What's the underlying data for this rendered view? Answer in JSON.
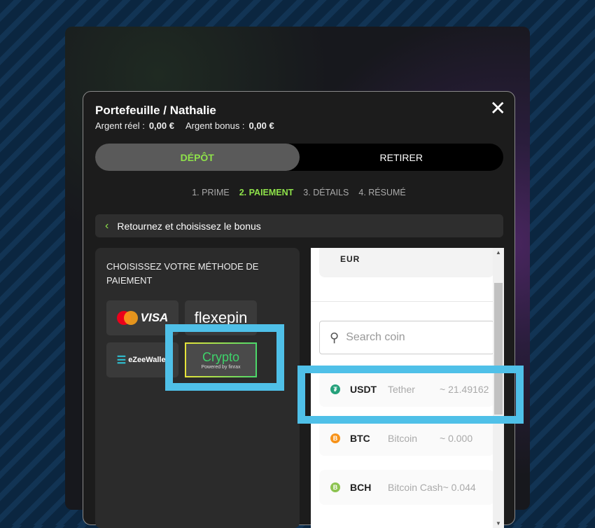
{
  "modal": {
    "title": "Portefeuille / Nathalie",
    "real_label": "Argent réel :",
    "real_value": "0,00 €",
    "bonus_label": "Argent bonus :",
    "bonus_value": "0,00 €",
    "close_icon": "close-icon"
  },
  "tabs": [
    {
      "label": "DÉPÔT",
      "active": true
    },
    {
      "label": "RETIRER",
      "active": false
    }
  ],
  "steps": [
    {
      "label": "1. PRIME"
    },
    {
      "label": "2. PAIEMENT",
      "current": true
    },
    {
      "label": "3. DÉTAILS"
    },
    {
      "label": "4. RÉSUMÉ"
    }
  ],
  "back": {
    "label": "Retournez et choisissez le bonus"
  },
  "methods": {
    "heading": "CHOISISSEZ VOTRE MÉTHODE DE PAIEMENT",
    "visa": "VISA",
    "mastercard": "mastercard",
    "flexepin": "flexepin",
    "ezeewallet": "eZeeWallet",
    "crypto": "Crypto",
    "crypto_sub": "Powered by finrax"
  },
  "coins": {
    "currency": "EUR",
    "search_placeholder": "Search coin",
    "list": [
      {
        "symbol": "USDT",
        "name": "Tether",
        "amount": "~ 21.49162",
        "color": "#26a17b"
      },
      {
        "symbol": "BTC",
        "name": "Bitcoin",
        "amount": "~ 0.000",
        "color": "#f7931a"
      },
      {
        "symbol": "BCH",
        "name": "Bitcoin Cash",
        "amount": "~ 0.044",
        "color": "#8dc351"
      }
    ]
  },
  "highlight_color": "#4fc0e8",
  "accent": "#8fe34a"
}
